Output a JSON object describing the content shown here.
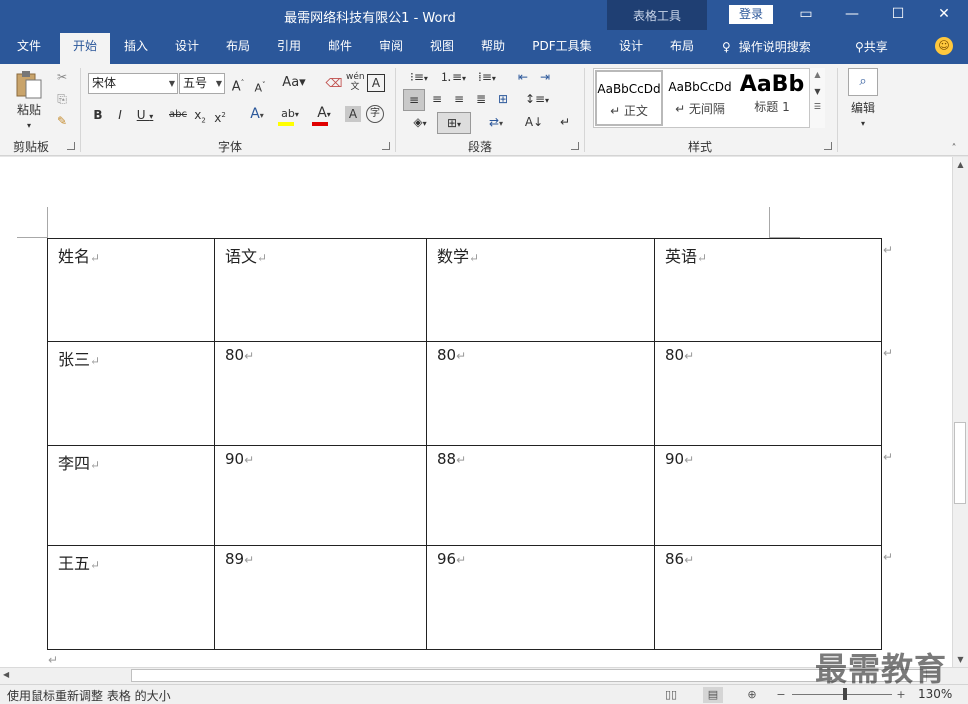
{
  "titlebar": {
    "document_title": "最需网络科技有限公1  -  Word",
    "context_tools": "表格工具",
    "login_label": "登录",
    "save_icon": "save-icon",
    "undo_icon": "undo-icon",
    "redo_icon": "redo-icon",
    "customize_icon": "customize-quick-access-icon"
  },
  "tabs": [
    {
      "label": "文件"
    },
    {
      "label": "开始"
    },
    {
      "label": "插入"
    },
    {
      "label": "设计"
    },
    {
      "label": "布局"
    },
    {
      "label": "引用"
    },
    {
      "label": "邮件"
    },
    {
      "label": "审阅"
    },
    {
      "label": "视图"
    },
    {
      "label": "帮助"
    },
    {
      "label": "PDF工具集"
    },
    {
      "label": "设计"
    },
    {
      "label": "布局"
    }
  ],
  "tell_me": "操作说明搜索",
  "share": "共享",
  "ribbon": {
    "clipboard": {
      "paste": "粘贴",
      "group": "剪贴板"
    },
    "font": {
      "name": "宋体",
      "size": "五号",
      "group": "字体"
    },
    "paragraph": {
      "group": "段落"
    },
    "styles": {
      "group": "样式",
      "items": [
        {
          "preview": "AaBbCcDd",
          "name": "↵ 正文"
        },
        {
          "preview": "AaBbCcDd",
          "name": "↵ 无间隔"
        },
        {
          "preview": "AaBb",
          "name": "标题 1"
        }
      ]
    },
    "editing": {
      "label": "编辑"
    }
  },
  "table": {
    "rows": [
      [
        "姓名",
        "语文",
        "数学",
        "英语"
      ],
      [
        "张三",
        "80",
        "80",
        "80"
      ],
      [
        "李四",
        "90",
        "88",
        "90"
      ],
      [
        "王五",
        "89",
        "96",
        "86"
      ]
    ]
  },
  "status": {
    "message": "使用鼠标重新调整 表格 的大小",
    "zoom": "130%"
  },
  "watermark": "最需教育",
  "colors": {
    "accent": "#2b579a",
    "context_band": "#1f3f73"
  }
}
